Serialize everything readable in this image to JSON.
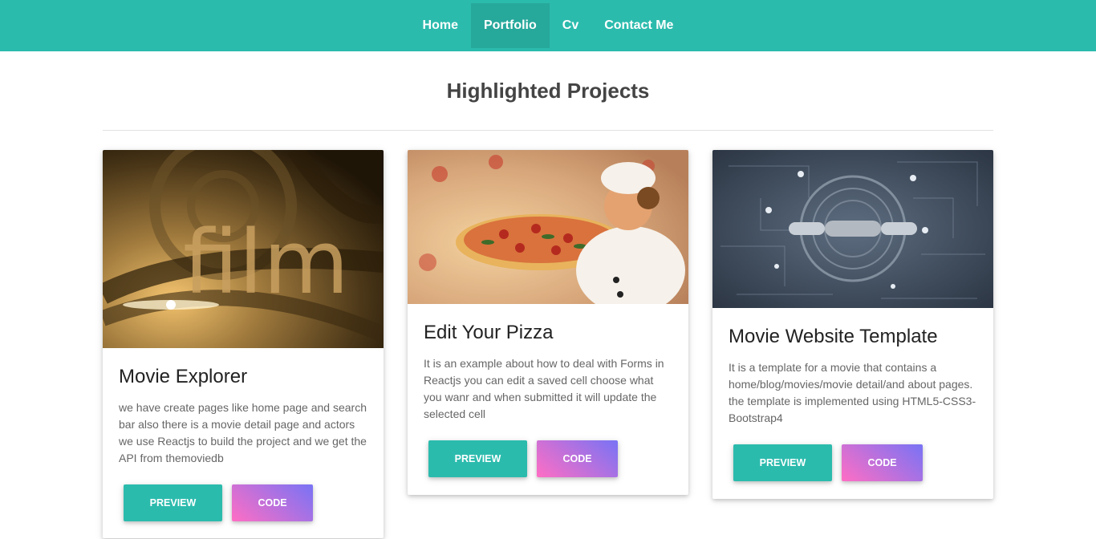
{
  "nav": {
    "items": [
      {
        "label": "Home"
      },
      {
        "label": "Portfolio"
      },
      {
        "label": "Cv"
      },
      {
        "label": "Contact Me"
      }
    ]
  },
  "page": {
    "title": "Highlighted Projects"
  },
  "projects": [
    {
      "title": "Movie Explorer",
      "image_text": "film",
      "description": "we have create pages like home page and search bar also there is a movie detail page and actors we use Reactjs to build the project and we get the API from themoviedb",
      "preview_label": "Preview",
      "code_label": "Code"
    },
    {
      "title": "Edit Your Pizza",
      "description": "It is an example about how to deal with Forms in Reactjs you can edit a saved cell choose what you wanr and when submitted it will update the selected cell",
      "preview_label": "Preview",
      "code_label": "Code"
    },
    {
      "title": "Movie Website Template",
      "description": "It is a template for a movie that contains a home/blog/movies/movie detail/and about pages. the template is implemented using HTML5-CSS3-Bootstrap4",
      "preview_label": "Preview",
      "code_label": "Code"
    }
  ],
  "colors": {
    "primary": "#2bbbad",
    "gradient_start": "#ff6ec4",
    "gradient_end": "#7873f5"
  }
}
